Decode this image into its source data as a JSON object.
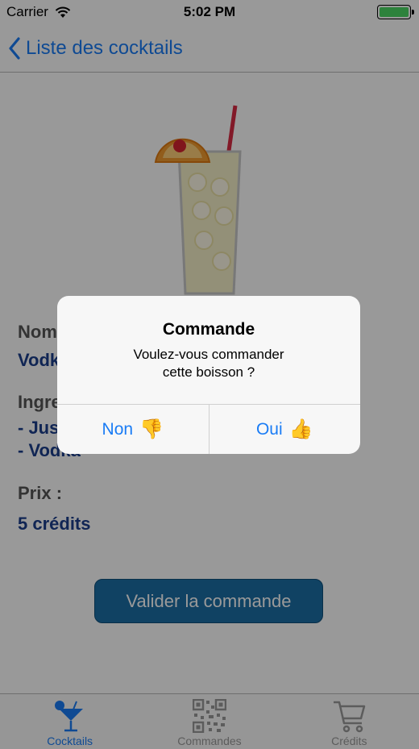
{
  "status_bar": {
    "carrier": "Carrier",
    "time": "5:02 PM"
  },
  "nav": {
    "back_label": "Liste des cocktails"
  },
  "detail": {
    "name_label": "Nom",
    "name_value": "Vodk",
    "ingredients_label": "Ingre",
    "ingredient_1": "- Jus",
    "ingredient_2": "- Vodka",
    "price_label": "Prix :",
    "price_value": "5 crédits"
  },
  "validate_button": "Valider la commande",
  "alert": {
    "title": "Commande",
    "message_line1": "Voulez-vous commander",
    "message_line2": "cette boisson ?",
    "no_label": "Non",
    "no_icon": "👎",
    "yes_label": "Oui",
    "yes_icon": "👍"
  },
  "tabs": [
    {
      "label": "Cocktails",
      "icon": "cocktail-icon",
      "active": true
    },
    {
      "label": "Commandes",
      "icon": "qr-code-icon",
      "active": false
    },
    {
      "label": "Crédits",
      "icon": "cart-icon",
      "active": false
    }
  ],
  "colors": {
    "accent": "#1a7cf5",
    "button": "#1b6ea6",
    "value_text": "#1c3f8c",
    "battery": "#4cd964"
  }
}
